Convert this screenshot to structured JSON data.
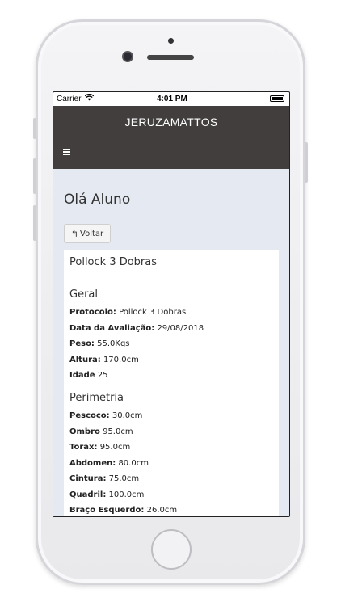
{
  "status_bar": {
    "carrier": "Carrier",
    "time": "4:01 PM"
  },
  "navbar": {
    "brand": "JERUZAMATTOS",
    "menu_icon": "hamburger-icon"
  },
  "page": {
    "greeting": "Olá Aluno",
    "back_label": "Voltar"
  },
  "evaluation": {
    "title": "Pollock 3 Dobras",
    "geral": {
      "heading": "Geral",
      "rows": [
        {
          "label": "Protocolo:",
          "value": "Pollock 3 Dobras"
        },
        {
          "label": "Data da Avaliação:",
          "value": "29/08/2018"
        },
        {
          "label": "Peso:",
          "value": "55.0Kgs"
        },
        {
          "label": "Altura:",
          "value": "170.0cm"
        },
        {
          "label": "Idade",
          "value": "25"
        }
      ]
    },
    "perimetria": {
      "heading": "Perimetria",
      "rows": [
        {
          "label": "Pescoço:",
          "value": "30.0cm"
        },
        {
          "label": "Ombro",
          "value": "95.0cm"
        },
        {
          "label": "Torax:",
          "value": "95.0cm"
        },
        {
          "label": "Abdomen:",
          "value": "80.0cm"
        },
        {
          "label": "Cintura:",
          "value": "75.0cm"
        },
        {
          "label": "Quadril:",
          "value": "100.0cm"
        },
        {
          "label": "Braço Esquerdo:",
          "value": "26.0cm"
        }
      ]
    }
  },
  "colors": {
    "navbar": "#413e3d",
    "content_bg": "#e5e9f1"
  }
}
